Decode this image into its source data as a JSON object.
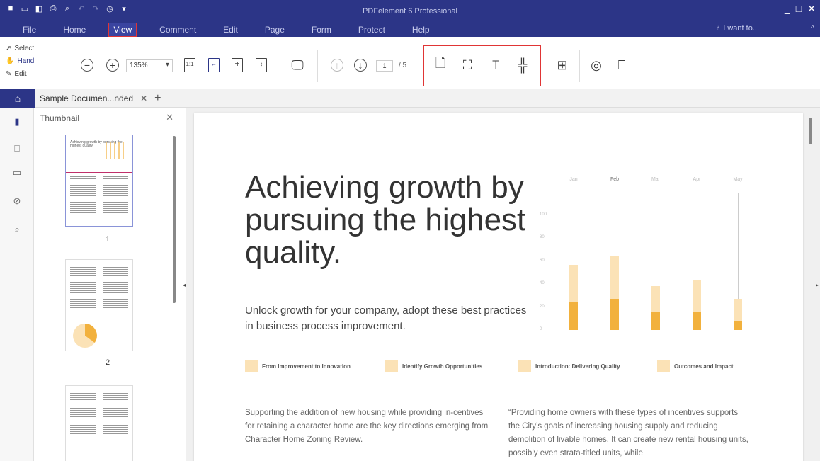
{
  "app": {
    "title": "PDFelement 6 Professional",
    "menus": [
      "File",
      "Home",
      "View",
      "Comment",
      "Edit",
      "Page",
      "Form",
      "Protect",
      "Help"
    ],
    "active_menu": "View",
    "i_want_to": "I want to...",
    "accent_color": "#2c3587",
    "highlight_color": "#e03535"
  },
  "ribbon": {
    "modes": {
      "select": "Select",
      "hand": "Hand",
      "edit": "Edit"
    },
    "zoom_value": "135%",
    "fit_icons": [
      "1:1"
    ],
    "current_page": "1",
    "page_total": "/ 5"
  },
  "tabs": {
    "document_tab": "Sample Documen...nded"
  },
  "sidebar": {
    "icons": [
      "pages-icon",
      "bookmark-icon",
      "comment-icon",
      "attachment-icon",
      "search-icon"
    ]
  },
  "thumbnail_panel": {
    "title": "Thumbnail",
    "pages": [
      {
        "label": "1",
        "caption": "Achieving growth by pursuing the highest quality."
      },
      {
        "label": "2"
      },
      {
        "label": "3"
      }
    ]
  },
  "document": {
    "headline": "Achieving growth by pursuing the highest quality.",
    "subtext": "Unlock growth for your company, adopt these best practices in business process improvement.",
    "steps": [
      "From Improvement to Innovation",
      "Identify Growth Opportunities",
      "Introduction: Delivering Quality",
      "Outcomes and Impact"
    ],
    "col1": "Supporting the addition of new housing while providing in-centives for retaining a character home are the key directions emerging from Character Home Zoning Review.",
    "col2": "“Providing home owners with these types of incentives supports the City’s goals of increasing housing supply and reducing demolition of livable homes. It can create new rental housing units, possibly even strata-titled units, while"
  },
  "chart_data": {
    "type": "bar",
    "categories": [
      "Jan",
      "Feb",
      "Mar",
      "Apr",
      "May"
    ],
    "y_ticks": [
      "100",
      "80",
      "60",
      "40",
      "20",
      "0"
    ],
    "series": [
      {
        "values": [
          57,
          64,
          38,
          43,
          27
        ]
      },
      {
        "values": [
          24,
          27,
          16,
          16,
          8
        ]
      }
    ],
    "ylim": [
      0,
      100
    ],
    "colors": [
      "#fbe2b6",
      "#f2b13d"
    ]
  }
}
